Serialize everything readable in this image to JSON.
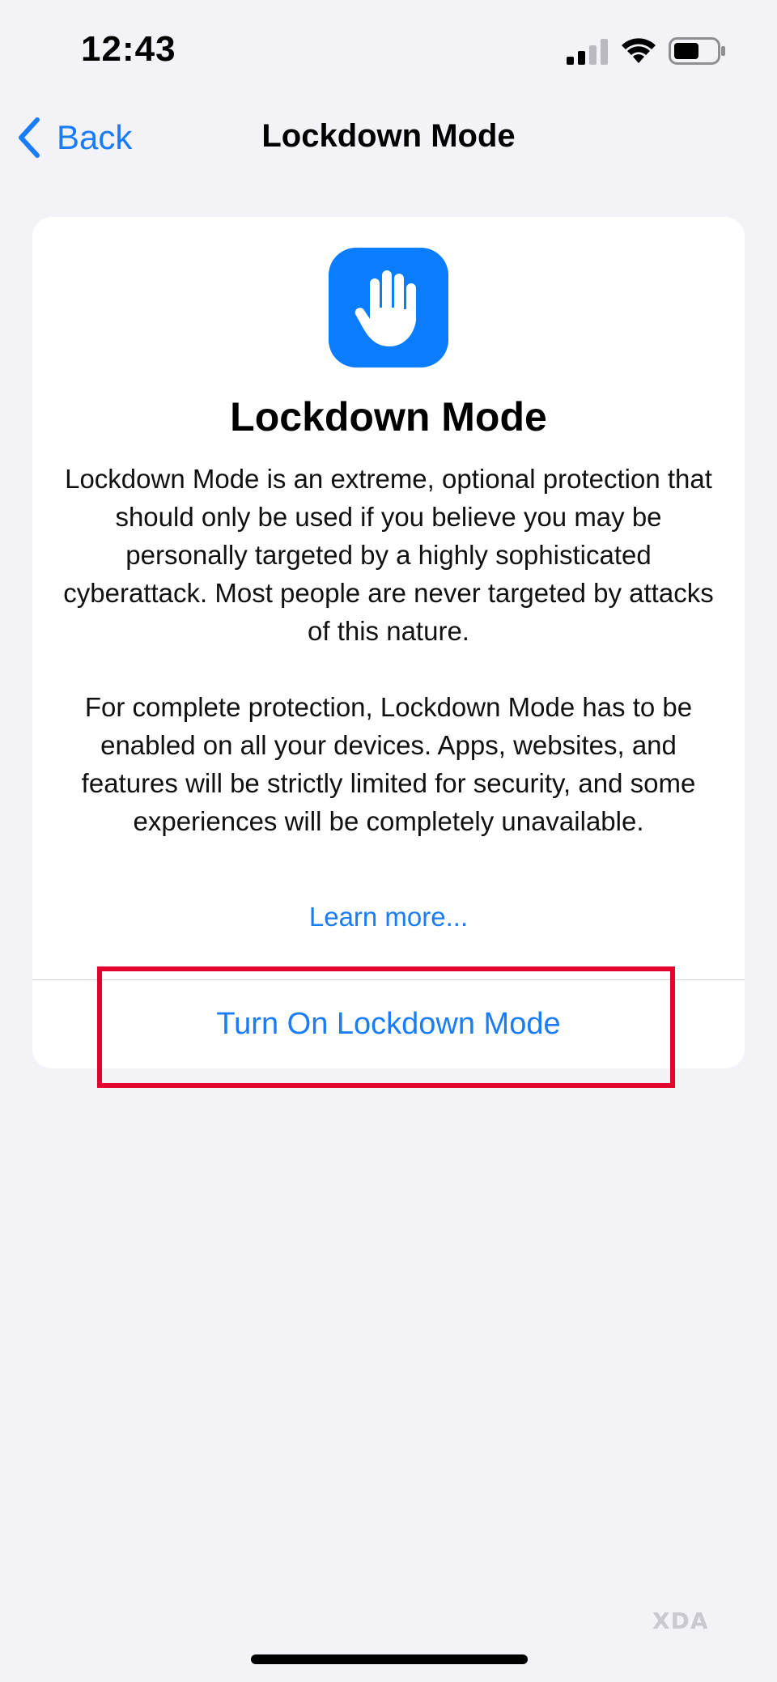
{
  "status_bar": {
    "time": "12:43"
  },
  "nav": {
    "back_label": "Back",
    "title": "Lockdown Mode"
  },
  "card": {
    "title": "Lockdown Mode",
    "description_1": "Lockdown Mode is an extreme, optional protection that should only be used if you believe you may be personally targeted by a highly sophisticated cyberattack. Most people are never targeted by attacks of this nature.",
    "description_2": "For complete protection, Lockdown Mode has to be enabled on all your devices. Apps, websites, and features will be strictly limited for security, and some experiences will be completely unavailable.",
    "learn_more": "Learn more...",
    "turn_on_button": "Turn On Lockdown Mode",
    "icon": "raised-hand-icon"
  },
  "watermark": {
    "text": "XDA"
  },
  "colors": {
    "accent": "#1a7cf6",
    "icon_background": "#0a7cff",
    "highlight": "#e4032e",
    "background": "#f2f2f7"
  }
}
